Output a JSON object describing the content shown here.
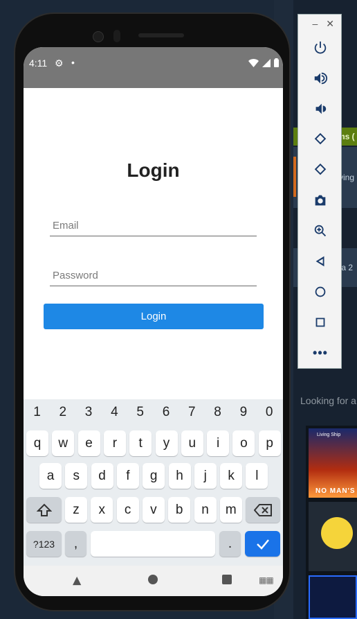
{
  "status_bar": {
    "time": "4:11"
  },
  "app": {
    "title": "Login",
    "email_placeholder": "Email",
    "password_placeholder": "Password",
    "login_button": "Login"
  },
  "keyboard": {
    "numbers": [
      "1",
      "2",
      "3",
      "4",
      "5",
      "6",
      "7",
      "8",
      "9",
      "0"
    ],
    "row1": [
      "q",
      "w",
      "e",
      "r",
      "t",
      "y",
      "u",
      "i",
      "o",
      "p"
    ],
    "row2": [
      "a",
      "s",
      "d",
      "f",
      "g",
      "h",
      "j",
      "k",
      "l"
    ],
    "row3": [
      "z",
      "x",
      "c",
      "v",
      "b",
      "n",
      "m"
    ],
    "symbols_key": "?123",
    "comma": ",",
    "period": "."
  },
  "emulator_toolbar": {
    "buttons": [
      "power-icon",
      "volume-up-icon",
      "volume-down-icon",
      "rotate-left-icon",
      "rotate-right-icon",
      "camera-icon",
      "zoom-icon",
      "back-icon",
      "home-icon",
      "overview-icon",
      "more-icon"
    ]
  },
  "background": {
    "green_label": "ms (",
    "card1_text": "ving",
    "card2_text": "ta 2",
    "looking_text": "Looking for a",
    "thumb1_top": "Living Ship",
    "thumb1_bottom": "NO MAN'S"
  },
  "colors": {
    "accent": "#1e88e5",
    "keyboard_bg": "#e9edf0",
    "status_bar": "#777777"
  }
}
